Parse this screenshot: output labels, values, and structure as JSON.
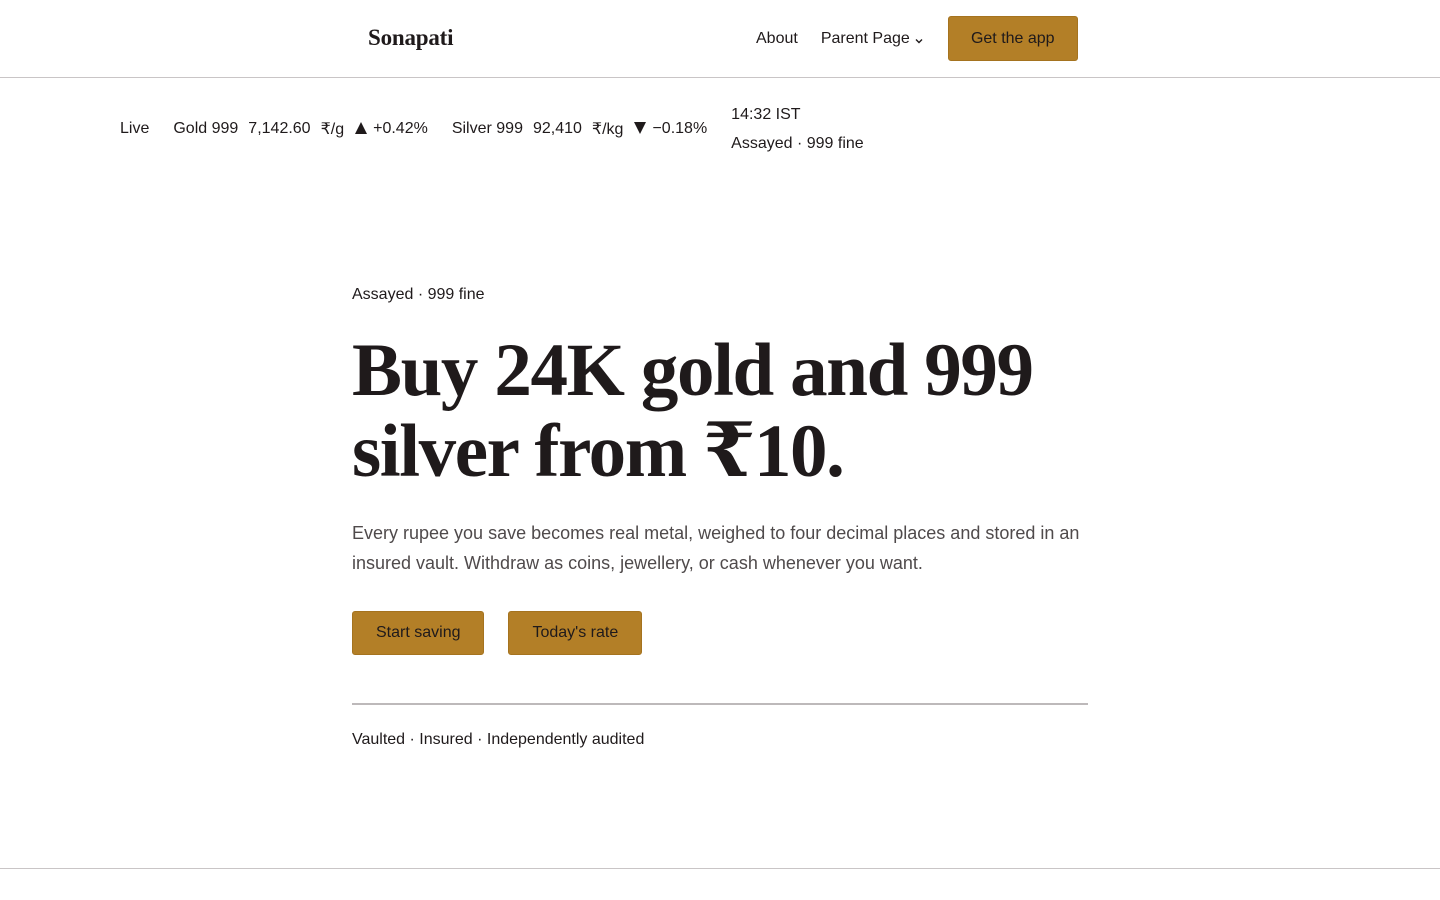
{
  "header": {
    "brand": "Sonapati",
    "nav": [
      {
        "label": "About"
      },
      {
        "label": "Parent Page"
      }
    ],
    "cta_label": "Get the app"
  },
  "ticker": {
    "live_label": "Live",
    "gold": {
      "name": "Gold 999",
      "price": "7,142.60",
      "unit": "₹/g",
      "change": "+0.42%",
      "direction": "up"
    },
    "silver": {
      "name": "Silver 999",
      "price": "92,410",
      "unit": "₹/kg",
      "change": "−0.18%",
      "direction": "down"
    },
    "time": "14:32 IST",
    "purity": "Assayed · 999 fine"
  },
  "hero": {
    "eyebrow": "Assayed · 999 fine",
    "title": "Buy 24K gold and 999 silver from ₹10.",
    "subtitle": "Every rupee you save becomes real metal, weighed to four decimal places and stored in an insured vault. Withdraw as coins, jewellery, or cash whenever you want.",
    "primary_cta": "Start saving",
    "secondary_cta": "Today's rate",
    "trust": "Vaulted · Insured · Independently audited"
  },
  "colors": {
    "accent": "#b37f27",
    "text": "#1f1a1b",
    "muted_text": "#4f4a4b",
    "rule": "#c9c5c6"
  },
  "icons": {
    "nav_dropdown": "chevron-down-icon",
    "gold_trend": "triangle-up-icon",
    "silver_trend": "triangle-down-icon"
  }
}
